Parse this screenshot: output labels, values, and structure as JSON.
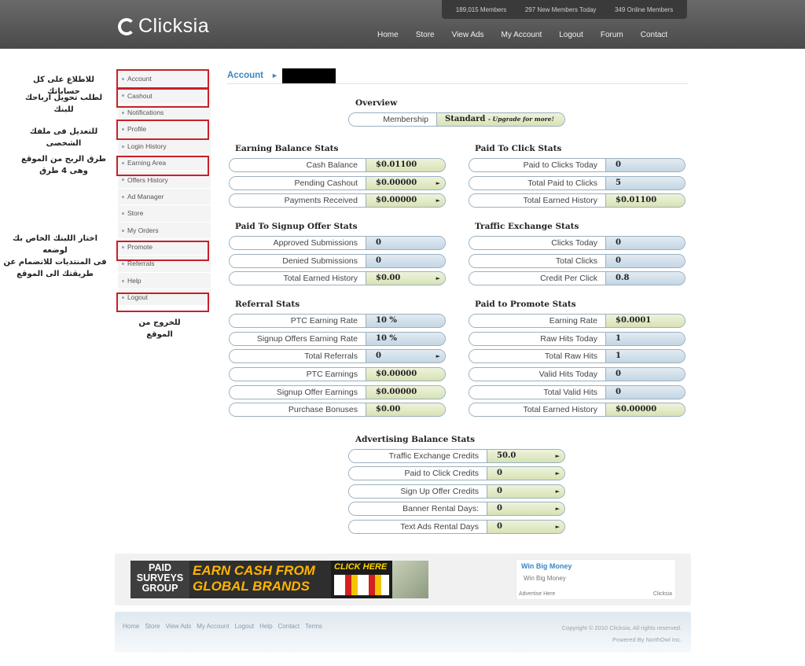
{
  "header": {
    "stats": [
      "189,015 Members",
      "297 New Members Today",
      "349 Online Members"
    ],
    "logo": "Clicksia",
    "nav": [
      "Home",
      "Store",
      "View Ads",
      "My Account",
      "Logout",
      "Forum",
      "Contact"
    ]
  },
  "annotations": {
    "account": "للاطلاع على كل حساباتك",
    "cashout": "لطلب تحويل ارباحك للبنك",
    "profile": "للتعديل فى ملفك الشخصى",
    "earning1": "طرق الربح من الموقع",
    "earning2": "وهى 4 طرق",
    "promote1": "اختار اللبنك الخاص بك لوضعه",
    "promote2": "فى المنتديات للانضمام عن",
    "promote3": "طريقتك الى الموقع",
    "logout": "للخروج من الموقع"
  },
  "sidebar": {
    "items": [
      "Account",
      "Cashout",
      "Notifications",
      "Profile",
      "Login History",
      "Earning Area",
      "Offers History",
      "Ad Manager",
      "Store",
      "My Orders",
      "Promote",
      "Referrals",
      "Help",
      "Logout"
    ]
  },
  "breadcrumb": {
    "label": "Account",
    "arrow": "►"
  },
  "overview": {
    "title": "Overview",
    "membership_label": "Membership",
    "membership_value": "Standard",
    "membership_upgrade": "- Upgrade for more!"
  },
  "earning_balance": {
    "title": "Earning Balance Stats",
    "rows": [
      {
        "label": "Cash Balance",
        "value": "$0.01100"
      },
      {
        "label": "Pending Cashout",
        "value": "$0.00000"
      },
      {
        "label": "Payments Received",
        "value": "$0.00000"
      }
    ]
  },
  "ptc": {
    "title": "Paid To Click Stats",
    "rows": [
      {
        "label": "Paid to Clicks Today",
        "value": "0"
      },
      {
        "label": "Total Paid to Clicks",
        "value": "5"
      },
      {
        "label": "Total Earned History",
        "value": "$0.01100"
      }
    ]
  },
  "signup": {
    "title": "Paid To Signup Offer Stats",
    "rows": [
      {
        "label": "Approved Submissions",
        "value": "0"
      },
      {
        "label": "Denied Submissions",
        "value": "0"
      },
      {
        "label": "Total Earned History",
        "value": "$0.00"
      }
    ]
  },
  "traffic": {
    "title": "Traffic Exchange Stats",
    "rows": [
      {
        "label": "Clicks Today",
        "value": "0"
      },
      {
        "label": "Total Clicks",
        "value": "0"
      },
      {
        "label": "Credit Per Click",
        "value": "0.8"
      }
    ]
  },
  "referral": {
    "title": "Referral Stats",
    "rows": [
      {
        "label": "PTC Earning Rate",
        "value": "10 %"
      },
      {
        "label": "Signup Offers Earning Rate",
        "value": "10 %"
      },
      {
        "label": "Total Referrals",
        "value": "0"
      },
      {
        "label": "PTC Earnings",
        "value": "$0.00000"
      },
      {
        "label": "Signup Offer Earnings",
        "value": "$0.00000"
      },
      {
        "label": "Purchase Bonuses",
        "value": "$0.00"
      }
    ]
  },
  "promote": {
    "title": "Paid to Promote Stats",
    "rows": [
      {
        "label": "Earning Rate",
        "value": "$0.0001"
      },
      {
        "label": "Raw Hits Today",
        "value": "1"
      },
      {
        "label": "Total Raw Hits",
        "value": "1"
      },
      {
        "label": "Valid Hits Today",
        "value": "0"
      },
      {
        "label": "Total Valid Hits",
        "value": "0"
      },
      {
        "label": "Total Earned History",
        "value": "$0.00000"
      }
    ]
  },
  "advertising": {
    "title": "Advertising Balance Stats",
    "rows": [
      {
        "label": "Traffic Exchange Credits",
        "value": "50.0"
      },
      {
        "label": "Paid to Click Credits",
        "value": "0"
      },
      {
        "label": "Sign Up Offer Credits",
        "value": "0"
      },
      {
        "label": "Banner Rental Days:",
        "value": "0"
      },
      {
        "label": "Text Ads Rental Days",
        "value": "0"
      }
    ]
  },
  "ad": {
    "banner_left": [
      "PAID",
      "SURVEYS",
      "GROUP"
    ],
    "banner_mid": [
      "EARN CASH FROM",
      "GLOBAL BRANDS"
    ],
    "banner_click": "CLICK HERE",
    "text_title": "Win Big Money",
    "text_desc": "Win Big Money",
    "advertise": "Advertise Here",
    "brand": "Clicksia"
  },
  "footer": {
    "nav": [
      "Home",
      "Store",
      "View Ads",
      "My Account",
      "Logout",
      "Help",
      "Contact",
      "Terms"
    ],
    "copyright": "Copyright © 2010 Clicksia, All rights reserved.",
    "powered": "Powered By NorthOwl Inc."
  }
}
